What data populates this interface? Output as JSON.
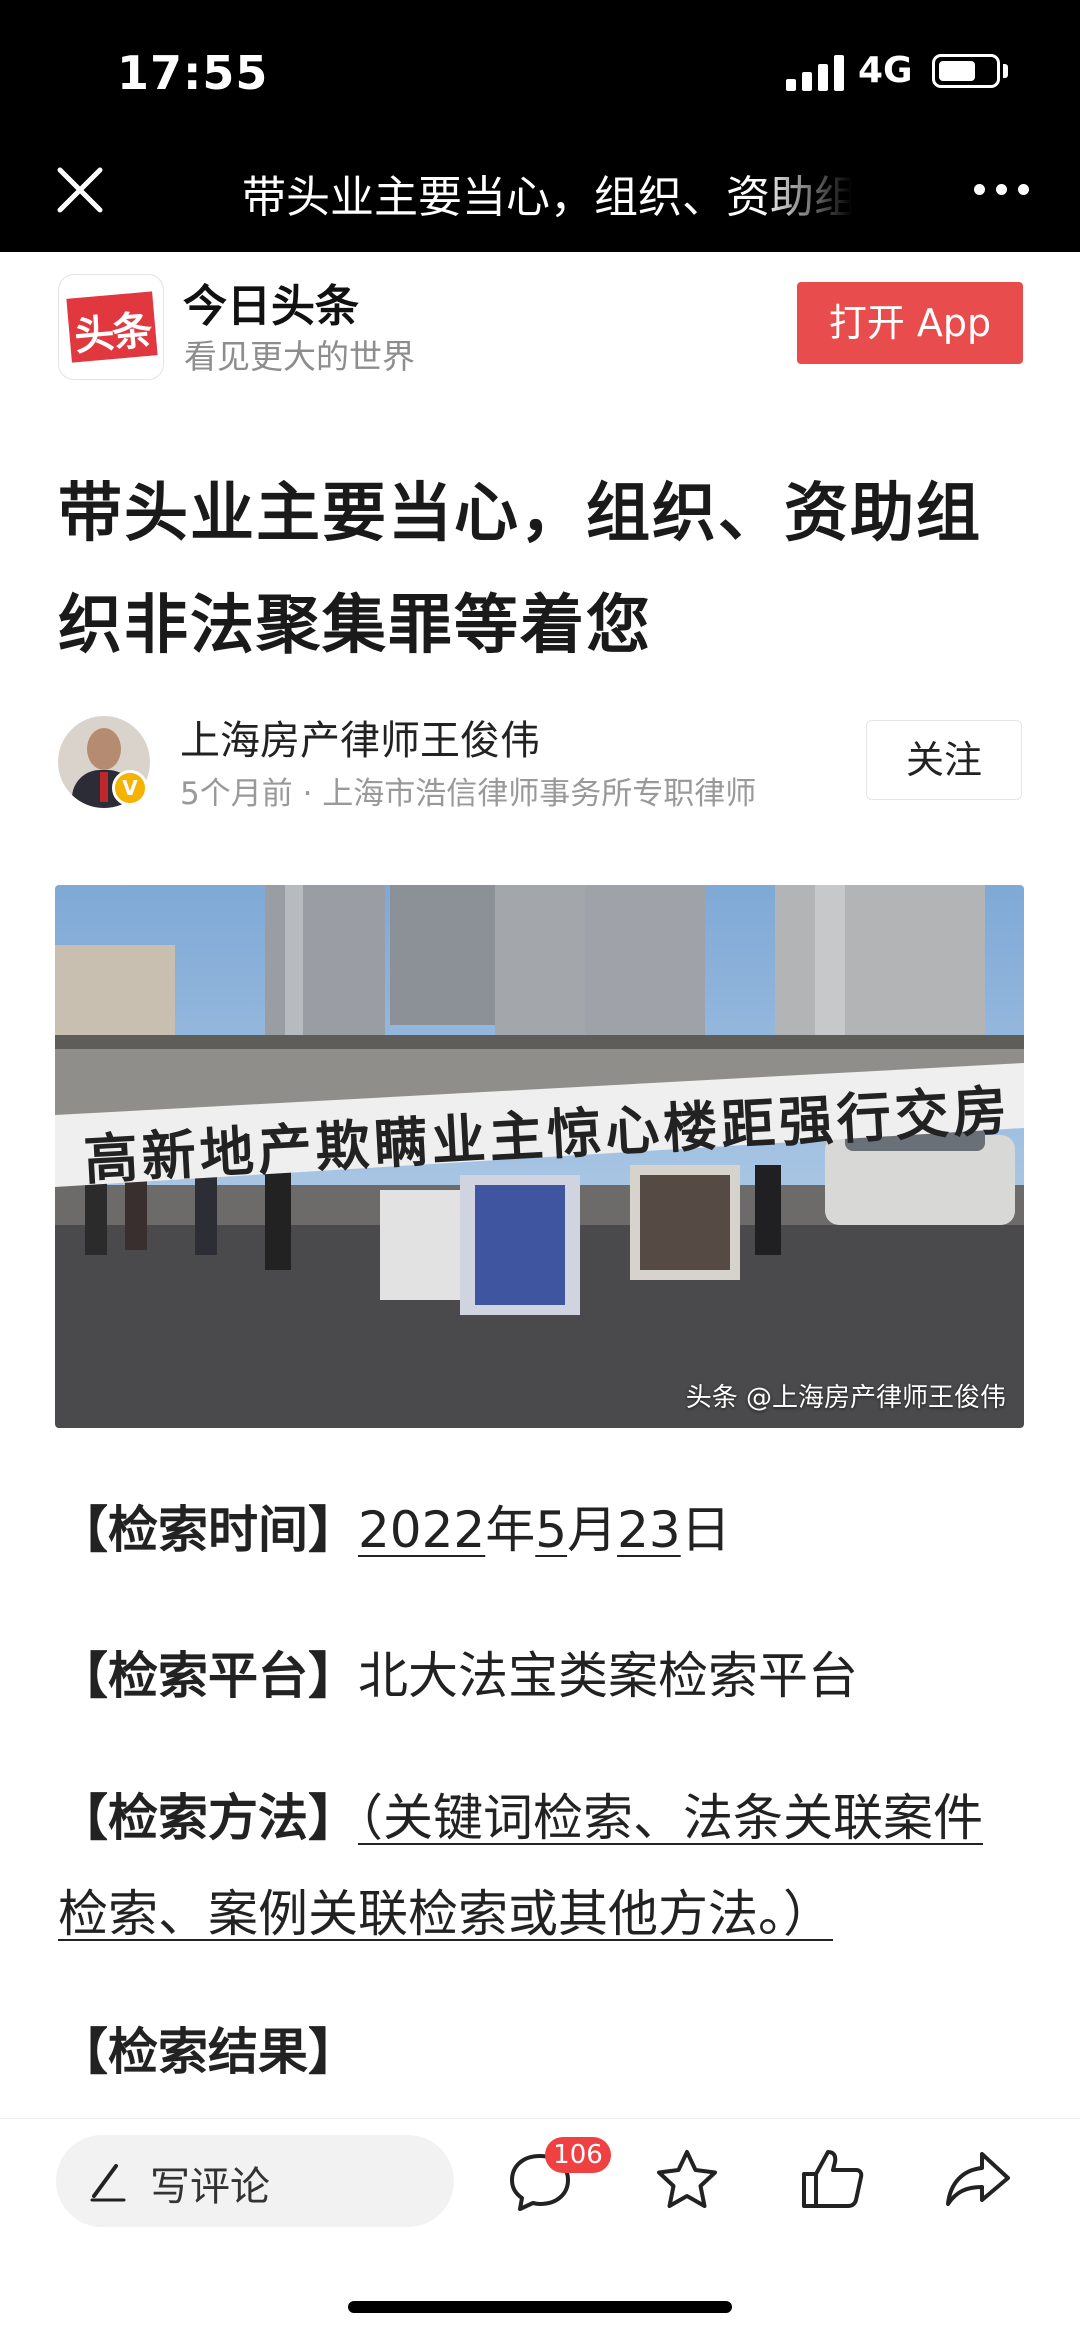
{
  "status_bar": {
    "time": "17:55",
    "network": "4G"
  },
  "nav": {
    "title": "带头业主要当心，组织、资助组织非法聚集罪等着您"
  },
  "app_banner": {
    "logo_text": "头条",
    "name": "今日头条",
    "slogan": "看见更大的世界",
    "open_button": "打开 App"
  },
  "article": {
    "title": "带头业主要当心，组织、资助组织非法聚集罪等着您",
    "author": {
      "name": "上海房产律师王俊伟",
      "meta": "5个月前 · 上海市浩信律师事务所专职律师",
      "follow": "关注",
      "verified_badge": "V"
    },
    "image": {
      "banner_text": "高新地产欺瞒业主惊心楼距强行交房",
      "watermark": "头条 @上海房产律师王俊伟"
    },
    "paragraphs": [
      {
        "label": "【检索时间】",
        "date_year": "2022",
        "y": "年",
        "date_month": "5",
        "m": "月",
        "date_day": "23",
        "d": "日"
      },
      {
        "label": "【检索平台】",
        "value": "北大法宝类案检索平台"
      },
      {
        "label": "【检索方法】",
        "value": "（关键词检索、法条关联案件检索、案例关联检索或其他方法。）"
      },
      {
        "label": "【检索结果】"
      }
    ]
  },
  "bottom_bar": {
    "comment_placeholder": "写评论",
    "comment_count": "106",
    "icons": [
      "pen-icon",
      "comment-icon",
      "star-icon",
      "like-icon",
      "share-icon"
    ]
  },
  "colors": {
    "brand_red": "#e1373f",
    "button_red": "#e94c4d",
    "badge_red": "#f04142"
  }
}
